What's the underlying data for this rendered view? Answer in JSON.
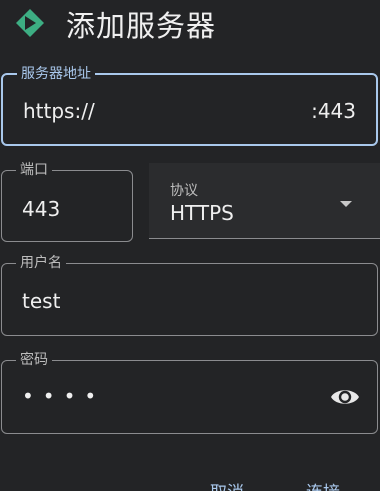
{
  "header": {
    "title": "添加服务器",
    "logo_icon": "app-logo-icon",
    "accent_color": "#3dae83"
  },
  "server": {
    "label": "服务器地址",
    "value": "https://",
    "port_suffix": ":443"
  },
  "port": {
    "label": "端口",
    "value": "443"
  },
  "protocol": {
    "label": "协议",
    "selected": "HTTPS"
  },
  "username": {
    "label": "用户名",
    "value": "test"
  },
  "password": {
    "label": "密码",
    "masked_value": "••••",
    "toggle_icon": "eye-icon"
  },
  "actions": {
    "cancel_label": "取消",
    "connect_label": "连接"
  },
  "colors": {
    "background": "#232426",
    "focus": "#a9c8ec",
    "outline": "#8b8c8f"
  }
}
